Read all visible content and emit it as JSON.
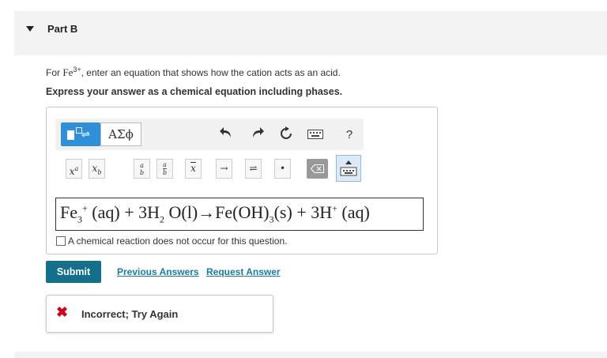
{
  "part": {
    "title": "Part B"
  },
  "question": {
    "prefix": "For ",
    "ion_base": "Fe",
    "ion_charge": "3+",
    "suffix": ", enter an equation that shows how the cation acts as an acid."
  },
  "instruction": "Express your answer as a chemical equation including phases.",
  "toolbar": {
    "greek_label": "ΑΣϕ",
    "help_label": "?",
    "keys": {
      "power": "x",
      "power_sup": "a",
      "sub": "x",
      "sub_sub": "b",
      "frac_num": "a",
      "frac_den": "b",
      "xbar": "x",
      "arrow": "→",
      "equilibrium": "⇌",
      "dot": "•"
    }
  },
  "equation": {
    "p1": "Fe",
    "p1_sub": "3",
    "p1_sup": "+",
    "p1_phase": "(aq)",
    "plus1": "+",
    "p2": "3H",
    "p2_sub": "2",
    "p2_rest": "O(l)",
    "arrow": "→",
    "p3": "Fe(OH)",
    "p3_sub": "3",
    "p3_phase": "(s)",
    "plus2": "+",
    "p4": "3H",
    "p4_sup": "+",
    "p4_phase": "(aq)"
  },
  "no_reaction_label": "A chemical reaction does not occur for this question.",
  "submit_label": "Submit",
  "links": {
    "previous": "Previous Answers",
    "request": "Request Answer"
  },
  "feedback": {
    "icon": "✖",
    "message": "Incorrect; Try Again",
    "color": "#d0021b"
  },
  "colors": {
    "accent": "#146f8a",
    "link": "#1a7ca2",
    "template_button": "#2f8fd8"
  }
}
